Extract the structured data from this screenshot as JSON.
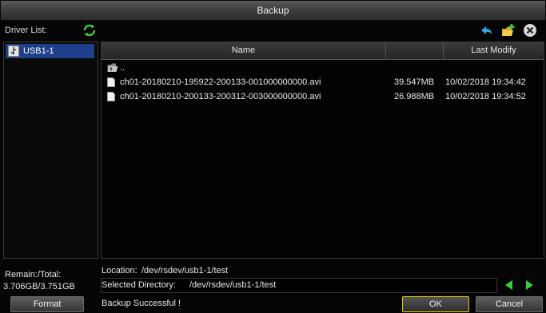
{
  "window": {
    "title": "Backup"
  },
  "toolbar": {
    "driver_list_label": "Driver List:",
    "refresh_icon": "refresh-icon",
    "back_icon": "back-arrow-icon",
    "new_folder_icon": "new-folder-icon",
    "close_icon": "close-icon"
  },
  "drivers": [
    {
      "label": "USB1-1",
      "selected": true
    }
  ],
  "table": {
    "headers": {
      "name": "Name",
      "size": "",
      "last_modify": "Last Modify"
    },
    "rows": [
      {
        "type": "parent",
        "name": "..",
        "size": "",
        "modified": ""
      },
      {
        "type": "file",
        "name": "ch01-20180210-195922-200133-001000000000.avi",
        "size": "39.547MB",
        "modified": "10/02/2018 19:34:42"
      },
      {
        "type": "file",
        "name": "ch01-20180210-200133-200312-003000000000.avi",
        "size": "26.988MB",
        "modified": "10/02/2018 19:34:52"
      }
    ]
  },
  "storage": {
    "label": "Remain:/Total:",
    "value": "3.706GB/3.751GB"
  },
  "location": {
    "label": "Location:",
    "path": "/dev/rsdev/usb1-1/test"
  },
  "selected_directory": {
    "label": "Selected Directory:",
    "path": "/dev/rsdev/usb1-1/test"
  },
  "status": "Backup Successful !",
  "buttons": {
    "format": "Format",
    "ok": "OK",
    "cancel": "Cancel"
  },
  "colors": {
    "selection": "#1f3f8a",
    "ok_border": "#e8c400",
    "nav_arrow": "#35d13a"
  }
}
